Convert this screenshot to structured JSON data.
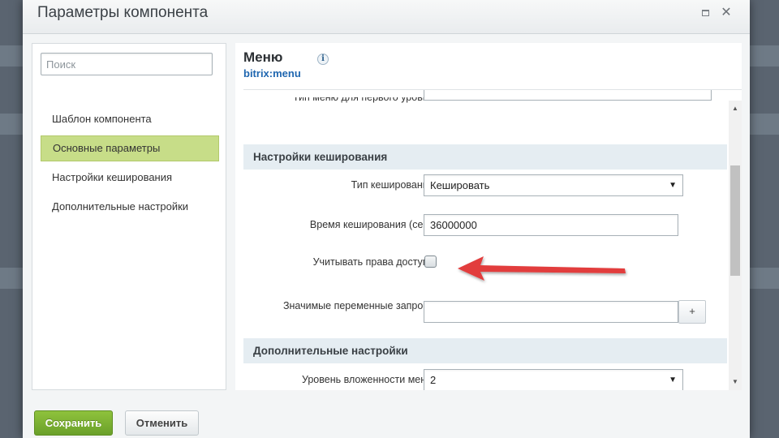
{
  "window": {
    "title": "Параметры компонента"
  },
  "sidebar": {
    "search_placeholder": "Поиск",
    "items": [
      {
        "label": "Шаблон компонента",
        "active": false
      },
      {
        "label": "Основные параметры",
        "active": true
      },
      {
        "label": "Настройки кеширования",
        "active": false
      },
      {
        "label": "Дополнительные настройки",
        "active": false
      }
    ]
  },
  "component": {
    "title": "Меню",
    "code": "bitrix:menu",
    "info_icon": "info-icon"
  },
  "form": {
    "menu_type_label": "Тип меню для первого уровня:",
    "caching_section": "Настройки кеширования",
    "cache_type_label": "Тип кеширования:",
    "cache_type_value": "Кешировать",
    "cache_time_label": "Время кеширования (сек.):",
    "cache_time_value": "36000000",
    "access_rights_label": "Учитывать права доступа:",
    "access_rights_checked": false,
    "request_vars_label": "Значимые переменные запроса:",
    "request_vars_value": "",
    "add_button": "+",
    "extra_section": "Дополнительные настройки",
    "nesting_label": "Уровень вложенности меню:",
    "nesting_value": "2"
  },
  "footer": {
    "save_label": "Сохранить",
    "cancel_label": "Отменить"
  },
  "colors": {
    "active_item": "#c7dd88",
    "save_button": "#7fb235",
    "section_bg": "#e5edf2",
    "link": "#2067b0",
    "arrow": "#e03a3a"
  }
}
